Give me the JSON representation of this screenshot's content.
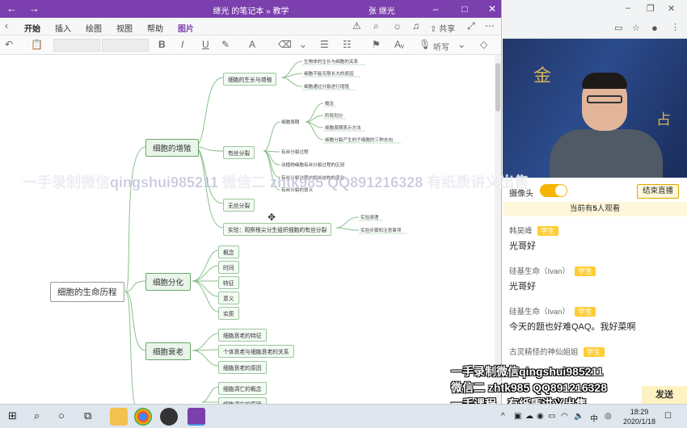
{
  "onenote": {
    "title": "继光 的笔记本 » 教学",
    "user": "张 继光",
    "tabs": [
      "开始",
      "插入",
      "绘图",
      "视图",
      "帮助",
      "图片"
    ],
    "share_label": "共享",
    "dictate_label": "听写"
  },
  "mindmap": {
    "root": "细胞的生命历程",
    "proliferation": {
      "label": "细胞的增殖",
      "growth": {
        "label": "细胞的生长与增殖",
        "leaves": [
          "生物体的生长与细胞的关系",
          "细胞不能无限长大的原因",
          "细胞通过分裂进行增殖"
        ]
      },
      "mitosis": {
        "label": "有丝分裂",
        "cycle": {
          "label": "细胞周期",
          "leaves": [
            "概念",
            "阶段划分",
            "细胞周期表示方法",
            "细胞分裂产生的子细胞的三种去向"
          ]
        },
        "leaves": [
          "有丝分裂过程",
          "动植物细胞有丝分裂过程的区别",
          "有丝分裂过程中相关结构的变化",
          "有丝分裂的意义"
        ]
      },
      "amitosis": "无丝分裂",
      "experiment": {
        "label": "实验：观察根尖分生组织细胞的有丝分裂",
        "leaves": [
          "实验原理",
          "实验步骤和注意事项"
        ]
      }
    },
    "differentiation": {
      "label": "细胞分化",
      "items": [
        "概念",
        "时间",
        "特征",
        "意义",
        "实质"
      ]
    },
    "aging": {
      "label": "细胞衰老",
      "items": [
        "细胞衰老的特征",
        "个体衰老与细胞衰老的关系",
        "细胞衰老的原因"
      ]
    },
    "death": {
      "items": [
        "细胞凋亡的概念",
        "细胞凋亡的原因"
      ]
    }
  },
  "live": {
    "camera_label": "摄像头",
    "camera_on": true,
    "end_live_label": "结束直播",
    "viewers_prefix": "当前有",
    "viewers_count": "5",
    "viewers_suffix": "人观看",
    "send_label": "发送",
    "chats": [
      {
        "name": "韩昊峰",
        "badge": "学生",
        "msg": "光哥好"
      },
      {
        "name": "硅基生命（Ivan）",
        "badge": "学生",
        "msg": "光哥好"
      },
      {
        "name": "硅基生命（Ivan）",
        "badge": "学生",
        "msg": "今天的题也好难QAQ。我好菜啊"
      },
      {
        "name": "古灵精怪的神仙姐姐",
        "badge": "学生",
        "msg": ""
      }
    ]
  },
  "watermarks": {
    "main": "一手录制微信qingshui985211  微信二 zhtk985  QQ891216328  有纸质讲义出售",
    "corner": [
      "一手录制微信qingshui985211",
      "微信二 zhtk985   QQ891216328",
      "一手课程，有纸质讲义出售"
    ]
  },
  "taskbar": {
    "time": "18:29",
    "date": "2020/1/18",
    "ime": "中"
  }
}
